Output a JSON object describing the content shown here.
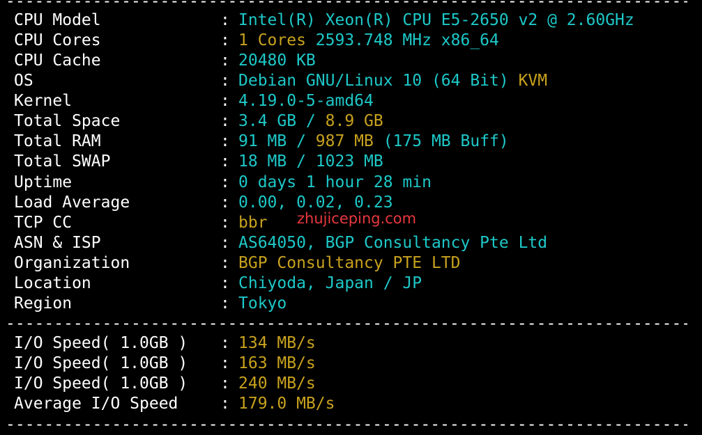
{
  "colors": {
    "background": "#000000",
    "label": "#ffffff",
    "cyan": "#1ec8c8",
    "yellow": "#c8a21e",
    "watermark": "#e8383f"
  },
  "colon": ":",
  "info": [
    {
      "label": "CPU Model",
      "parts": [
        {
          "text": "Intel(R) Xeon(R) CPU E5-2650 v2 @ 2.60GHz",
          "color": "cyan"
        }
      ]
    },
    {
      "label": "CPU Cores",
      "parts": [
        {
          "text": "1 Cores",
          "color": "yellow"
        },
        {
          "text": " 2593.748 MHz x86_64",
          "color": "cyan"
        }
      ]
    },
    {
      "label": "CPU Cache",
      "parts": [
        {
          "text": "20480 KB",
          "color": "cyan"
        }
      ]
    },
    {
      "label": "OS",
      "parts": [
        {
          "text": "Debian GNU/Linux 10 (64 Bit)",
          "color": "cyan"
        },
        {
          "text": " KVM",
          "color": "yellow"
        }
      ]
    },
    {
      "label": "Kernel",
      "parts": [
        {
          "text": "4.19.0-5-amd64",
          "color": "cyan"
        }
      ]
    },
    {
      "label": "Total Space",
      "parts": [
        {
          "text": "3.4 GB / ",
          "color": "cyan"
        },
        {
          "text": "8.9 GB",
          "color": "yellow"
        }
      ]
    },
    {
      "label": "Total RAM",
      "parts": [
        {
          "text": "91 MB / ",
          "color": "cyan"
        },
        {
          "text": "987 MB",
          "color": "yellow"
        },
        {
          "text": " (175 MB Buff)",
          "color": "cyan"
        }
      ]
    },
    {
      "label": "Total SWAP",
      "parts": [
        {
          "text": "18 MB / 1023 MB",
          "color": "cyan"
        }
      ]
    },
    {
      "label": "Uptime",
      "parts": [
        {
          "text": "0 days 1 hour 28 min",
          "color": "cyan"
        }
      ]
    },
    {
      "label": "Load Average",
      "parts": [
        {
          "text": "0.00, 0.02, 0.23",
          "color": "cyan"
        }
      ]
    },
    {
      "label": "TCP CC",
      "parts": [
        {
          "text": "bbr",
          "color": "yellow"
        }
      ]
    },
    {
      "label": "ASN & ISP",
      "parts": [
        {
          "text": "AS64050, BGP Consultancy Pte Ltd",
          "color": "cyan"
        }
      ]
    },
    {
      "label": "Organization",
      "parts": [
        {
          "text": "BGP Consultancy PTE LTD",
          "color": "yellow"
        }
      ]
    },
    {
      "label": "Location",
      "parts": [
        {
          "text": "Chiyoda, Japan / JP",
          "color": "cyan"
        }
      ]
    },
    {
      "label": "Region",
      "parts": [
        {
          "text": "Tokyo",
          "color": "cyan"
        }
      ]
    }
  ],
  "io": [
    {
      "label": "I/O Speed( 1.0GB )",
      "parts": [
        {
          "text": "134 MB/s",
          "color": "yellow"
        }
      ]
    },
    {
      "label": "I/O Speed( 1.0GB )",
      "parts": [
        {
          "text": "163 MB/s",
          "color": "yellow"
        }
      ]
    },
    {
      "label": "I/O Speed( 1.0GB )",
      "parts": [
        {
          "text": "240 MB/s",
          "color": "yellow"
        }
      ]
    },
    {
      "label": "Average I/O Speed",
      "parts": [
        {
          "text": "179.0 MB/s",
          "color": "yellow"
        }
      ]
    }
  ],
  "watermark": "zhujiceping.com"
}
